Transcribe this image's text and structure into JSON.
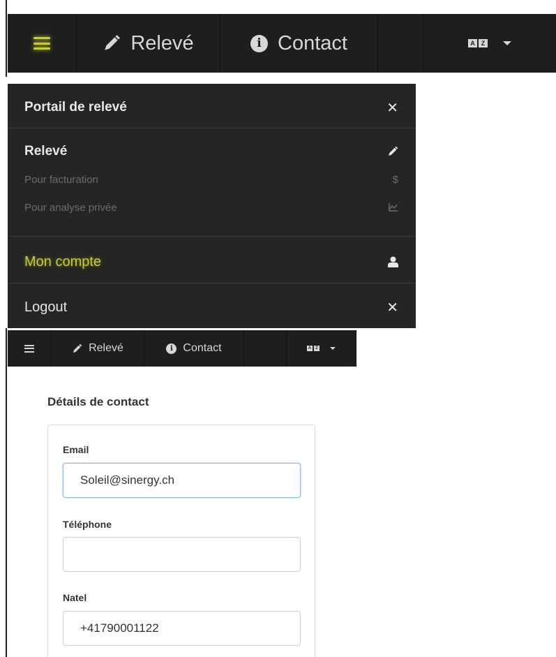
{
  "top_nav": {
    "releve_label": "Relevé",
    "contact_label": "Contact",
    "lang_icon_chars": [
      "A",
      "Z"
    ]
  },
  "menu": {
    "title": "Portail de relevé",
    "releve_label": "Relevé",
    "sub_items": [
      {
        "label": "Pour facturation",
        "icon": "$"
      },
      {
        "label": "Pour analyse privée",
        "icon": "chart-icon"
      }
    ],
    "account_label": "Mon compte",
    "logout_label": "Logout",
    "close_glyph": "✕"
  },
  "small_nav": {
    "releve_label": "Relevé",
    "contact_label": "Contact"
  },
  "contact_form": {
    "title": "Détails de contact",
    "email": {
      "label": "Email",
      "value": "Soleil@sinergy.ch"
    },
    "telephone": {
      "label": "Téléphone",
      "value": ""
    },
    "natel": {
      "label": "Natel",
      "value": "+41790001122"
    }
  },
  "colors": {
    "nav_bg": "#1e1e1e",
    "menu_bg": "#252525",
    "highlight_yellow": "#c9cf2e",
    "focus_border": "#8fb8e6"
  }
}
